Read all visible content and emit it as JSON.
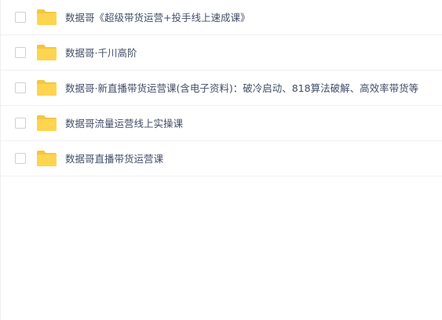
{
  "file_list": {
    "items": [
      {
        "name": "数据哥《超级带货运营+投手线上速成课》",
        "icon": "folder-icon"
      },
      {
        "name": "数据哥·千川高阶",
        "icon": "folder-icon"
      },
      {
        "name": "数据哥·新直播带货运营课(含电子资料)：破冷启动、818算法破解、高效率带货等",
        "icon": "folder-icon"
      },
      {
        "name": "数据哥流量运营线上实操课",
        "icon": "folder-icon"
      },
      {
        "name": "数据哥直播带货运营课",
        "icon": "folder-icon"
      }
    ]
  },
  "colors": {
    "folder_fill": "#ffd44f",
    "folder_tab": "#f5c542",
    "text": "#424e67",
    "divider": "#f0f0f0",
    "checkbox_border": "#d0d0d0"
  }
}
